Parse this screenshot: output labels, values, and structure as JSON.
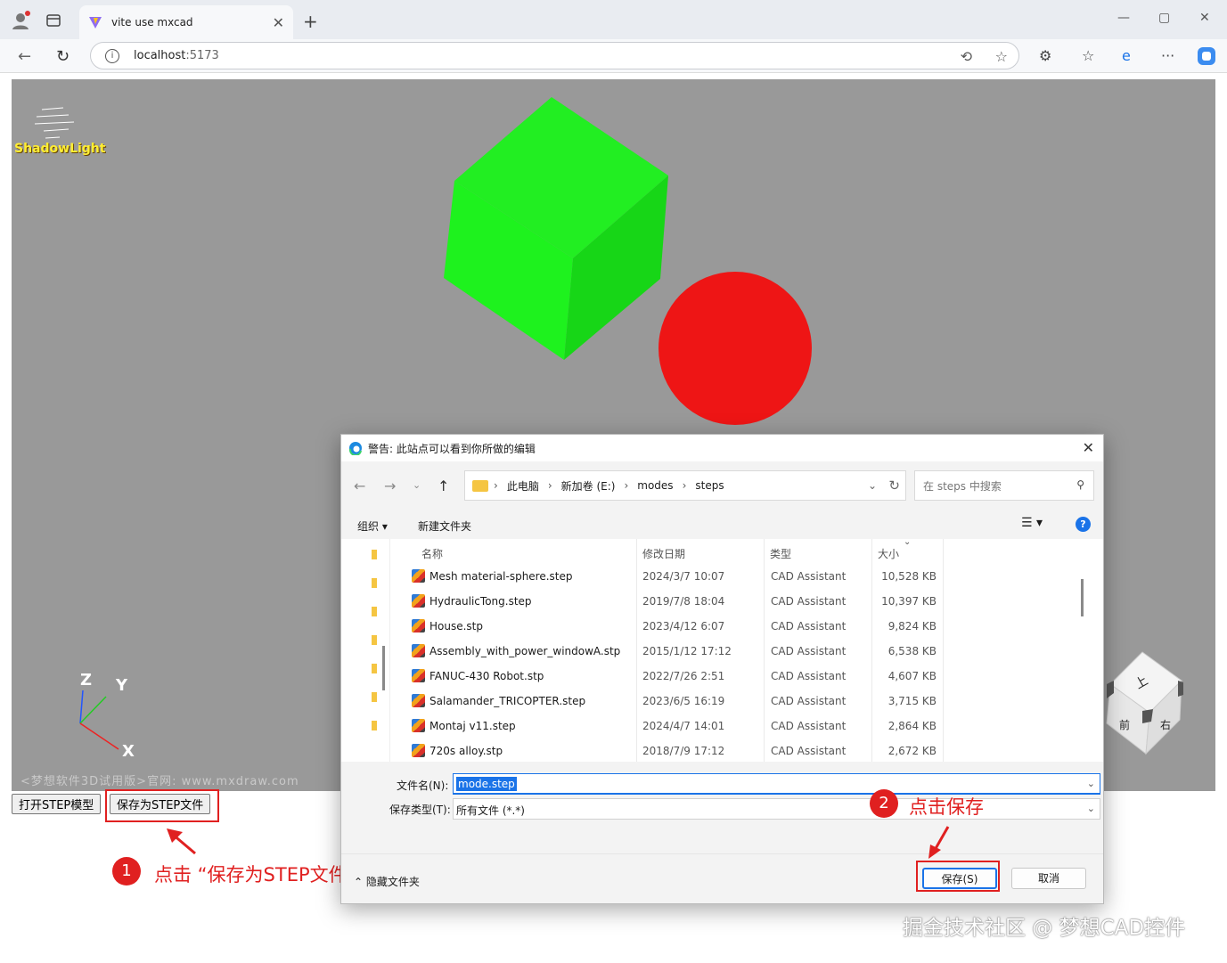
{
  "browser": {
    "tab_title": "vite use mxcad",
    "url_host": "localhost",
    "url_port": ":5173"
  },
  "page": {
    "overlay_label": "ShadowLight",
    "watermark": "<梦想软件3D试用版>官网: www.mxdraw.com",
    "axis": {
      "z": "Z",
      "y": "Y",
      "x": "X"
    },
    "buttons": {
      "open_step": "打开STEP模型",
      "save_step": "保存为STEP文件"
    },
    "viewcube_faces": {
      "top": "上",
      "front": "前",
      "right": "右"
    }
  },
  "annotations": {
    "step1_num": "1",
    "step1_text": "点击 “保存为STEP文件”按钮",
    "step2_num": "2",
    "step2_text": "点击保存",
    "bottom_watermark": "掘金技术社区 @ 梦想CAD控件",
    "accent_color": "#e02020"
  },
  "dialog": {
    "title": "警告: 此站点可以看到你所做的编辑",
    "breadcrumbs": [
      "此电脑",
      "新加卷 (E:)",
      "modes",
      "steps"
    ],
    "search_placeholder": "在 steps 中搜索",
    "toolbar": {
      "organize": "组织 ▾",
      "new_folder": "新建文件夹"
    },
    "columns": {
      "name": "名称",
      "date": "修改日期",
      "type": "类型",
      "size": "大小"
    },
    "files": [
      {
        "name": "Mesh material-sphere.step",
        "date": "2024/3/7 10:07",
        "type": "CAD Assistant",
        "size": "10,528 KB"
      },
      {
        "name": "HydraulicTong.step",
        "date": "2019/7/8 18:04",
        "type": "CAD Assistant",
        "size": "10,397 KB"
      },
      {
        "name": "House.stp",
        "date": "2023/4/12 6:07",
        "type": "CAD Assistant",
        "size": "9,824 KB"
      },
      {
        "name": "Assembly_with_power_windowA.stp",
        "date": "2015/1/12 17:12",
        "type": "CAD Assistant",
        "size": "6,538 KB"
      },
      {
        "name": "FANUC-430 Robot.stp",
        "date": "2022/7/26 2:51",
        "type": "CAD Assistant",
        "size": "4,607 KB"
      },
      {
        "name": "Salamander_TRICOPTER.step",
        "date": "2023/6/5 16:19",
        "type": "CAD Assistant",
        "size": "3,715 KB"
      },
      {
        "name": "Montaj v11.step",
        "date": "2024/4/7 14:01",
        "type": "CAD Assistant",
        "size": "2,864 KB"
      },
      {
        "name": "720s alloy.stp",
        "date": "2018/7/9 17:12",
        "type": "CAD Assistant",
        "size": "2,672 KB"
      }
    ],
    "filename_label": "文件名(N):",
    "filename_value": "mode.step",
    "filetype_label": "保存类型(T):",
    "filetype_value": "所有文件 (*.*)",
    "hide_folders": "隐藏文件夹",
    "save_button": "保存(S)",
    "cancel_button": "取消"
  }
}
